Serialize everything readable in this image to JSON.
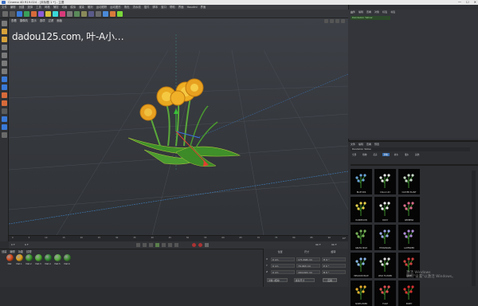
{
  "window": {
    "title": "Cinema 4D R19.024 - [未标题 1 *] - 主要",
    "controls": [
      "—",
      "☐",
      "✕"
    ]
  },
  "menubar": [
    "文件",
    "编辑",
    "创建",
    "选择",
    "工具",
    "网格",
    "捕捉",
    "动画",
    "模拟",
    "渲染",
    "雕刻",
    "运动跟踪",
    "运动图形",
    "角色",
    "流水线",
    "插件",
    "脚本",
    "窗口",
    "帮助",
    "界面",
    "Houdini",
    "界面"
  ],
  "viewport": {
    "menu": [
      "查看",
      "摄像机",
      "显示",
      "选项",
      "过滤",
      "面板"
    ],
    "caption": "dadou125.com, 叶-A小…",
    "scene": "flower-plant"
  },
  "timeline": {
    "ticks": [
      "0",
      "5",
      "10",
      "15",
      "20",
      "25",
      "30",
      "35",
      "40",
      "45",
      "50",
      "55",
      "60",
      "65",
      "70",
      "75",
      "80",
      "85",
      "90"
    ],
    "end_label": "0 F"
  },
  "transport": {
    "start": "0 F",
    "current": "0 F",
    "end": "90 F",
    "end2": "90 F"
  },
  "material_panel": {
    "menu": [
      "创建",
      "编辑",
      "功能",
      "纹理"
    ],
    "materials": [
      {
        "label": "Mat",
        "color": "#d94a1a"
      },
      {
        "label": "Mat.1",
        "color": "#e0a018"
      },
      {
        "label": "Mat.2",
        "color": "#3a9a2a"
      },
      {
        "label": "Mat.3",
        "color": "#4cb030"
      },
      {
        "label": "Mat.4",
        "color": "#2f8f2f"
      },
      {
        "label": "Mat.5",
        "color": "#58b040"
      },
      {
        "label": "Mat.6",
        "color": "#3c8c30"
      }
    ]
  },
  "coords": {
    "header": [
      "位置",
      "尺寸",
      "旋转"
    ],
    "rows": [
      {
        "axis": "X",
        "pos": "0 cm",
        "size": "171.696 cm",
        "rot": "H 0 °"
      },
      {
        "axis": "Y",
        "pos": "0 cm",
        "size": "79.463 cm",
        "rot": "P 0 °"
      },
      {
        "axis": "Z",
        "pos": "0 cm",
        "size": "164.022 cm",
        "rot": "B 0 °"
      }
    ],
    "mode": "对象 (相对)",
    "size_mode": "绝对尺寸",
    "apply": "应用"
  },
  "object_manager": {
    "menu": [
      "文件",
      "编辑",
      "查看",
      "对象",
      "标签",
      "书签"
    ],
    "object": "Dandelion Yellow"
  },
  "asset_browser": {
    "menu": [
      "文件",
      "编辑",
      "查看",
      "预置"
    ],
    "path": "Dandelion Yellow",
    "tabs": [
      "全部",
      "植物",
      "花卉",
      "草地",
      "树木",
      "灌木",
      "其他"
    ],
    "items": [
      {
        "label": "BLUE IRIS",
        "c": "#6aa4d8"
      },
      {
        "label": "CALLA LILY",
        "c": "#e8e8e8"
      },
      {
        "label": "CLOVER PLANT",
        "c": "#c8d8c8"
      },
      {
        "label": "DANDELION",
        "c": "#e8d04a"
      },
      {
        "label": "DAISY",
        "c": "#f0f0f0"
      },
      {
        "label": "GERBERA",
        "c": "#d86a8a"
      },
      {
        "label": "GRASS WILD",
        "c": "#7ab05a"
      },
      {
        "label": "HYDRANGEA",
        "c": "#9aa8e8"
      },
      {
        "label": "LAVENDER",
        "c": "#b08ad8"
      },
      {
        "label": "MEADOW BLUE",
        "c": "#8ab4e8"
      },
      {
        "label": "WILD FLOWER",
        "c": "#e0e0e0"
      },
      {
        "label": "ROSE",
        "c": "#d04040"
      },
      {
        "label": "SUNFLOWER",
        "c": "#e8b030"
      },
      {
        "label": "TULIP",
        "c": "#e05050"
      },
      {
        "label": "POPPY",
        "c": "#d83030"
      }
    ]
  },
  "watermark": "激活 Windows\n转到\"设置\"以激活 Windows。"
}
